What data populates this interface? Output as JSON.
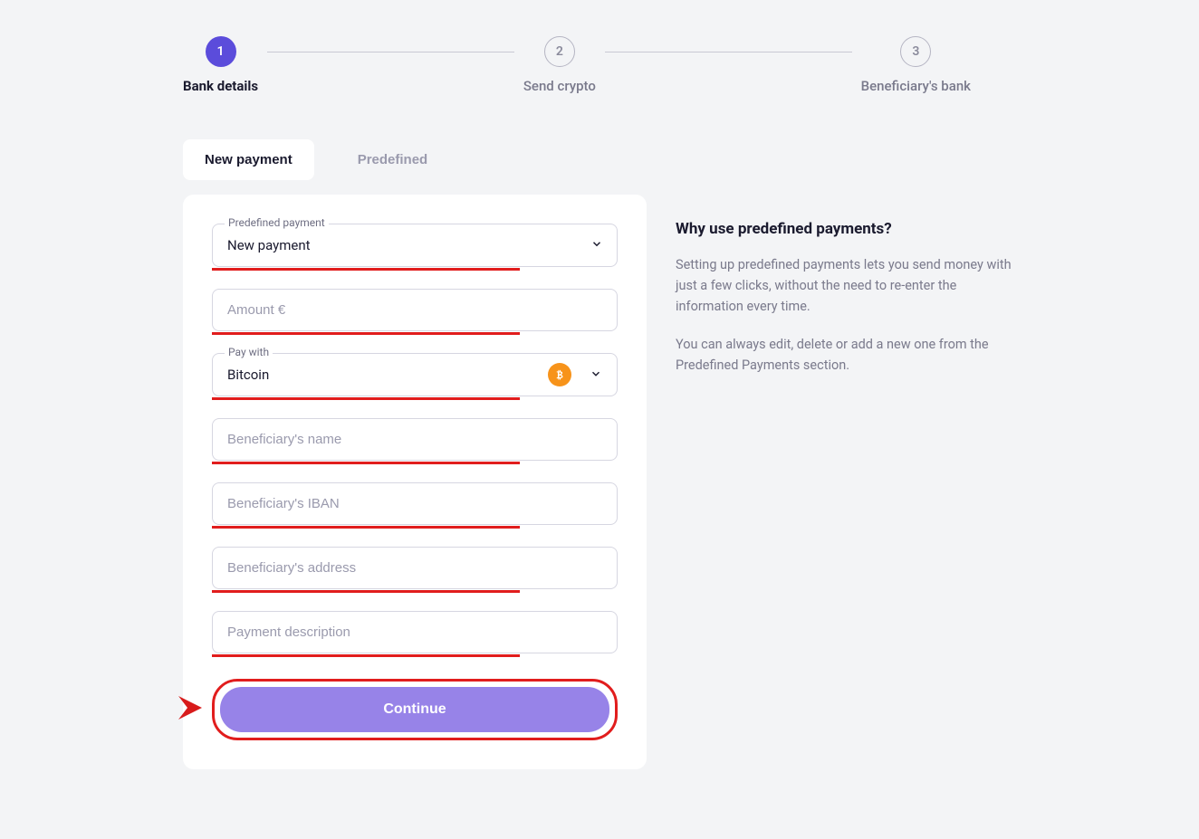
{
  "stepper": {
    "steps": [
      {
        "number": "1",
        "label": "Bank details",
        "active": true
      },
      {
        "number": "2",
        "label": "Send crypto",
        "active": false
      },
      {
        "number": "3",
        "label": "Beneficiary's bank",
        "active": false
      }
    ]
  },
  "tabs": {
    "new_payment": "New payment",
    "predefined": "Predefined"
  },
  "form": {
    "predefined_label": "Predefined payment",
    "predefined_value": "New payment",
    "amount_placeholder": "Amount €",
    "pay_with_label": "Pay with",
    "pay_with_value": "Bitcoin",
    "beneficiary_name_placeholder": "Beneficiary's name",
    "beneficiary_iban_placeholder": "Beneficiary's IBAN",
    "beneficiary_address_placeholder": "Beneficiary's address",
    "payment_description_placeholder": "Payment description",
    "continue_label": "Continue"
  },
  "info": {
    "title": "Why use predefined payments?",
    "p1": "Setting up predefined payments lets you send money with just a few clicks, without the need to re-enter the information every time.",
    "p2": "You can always edit, delete or add a new one from the Predefined Payments section."
  }
}
